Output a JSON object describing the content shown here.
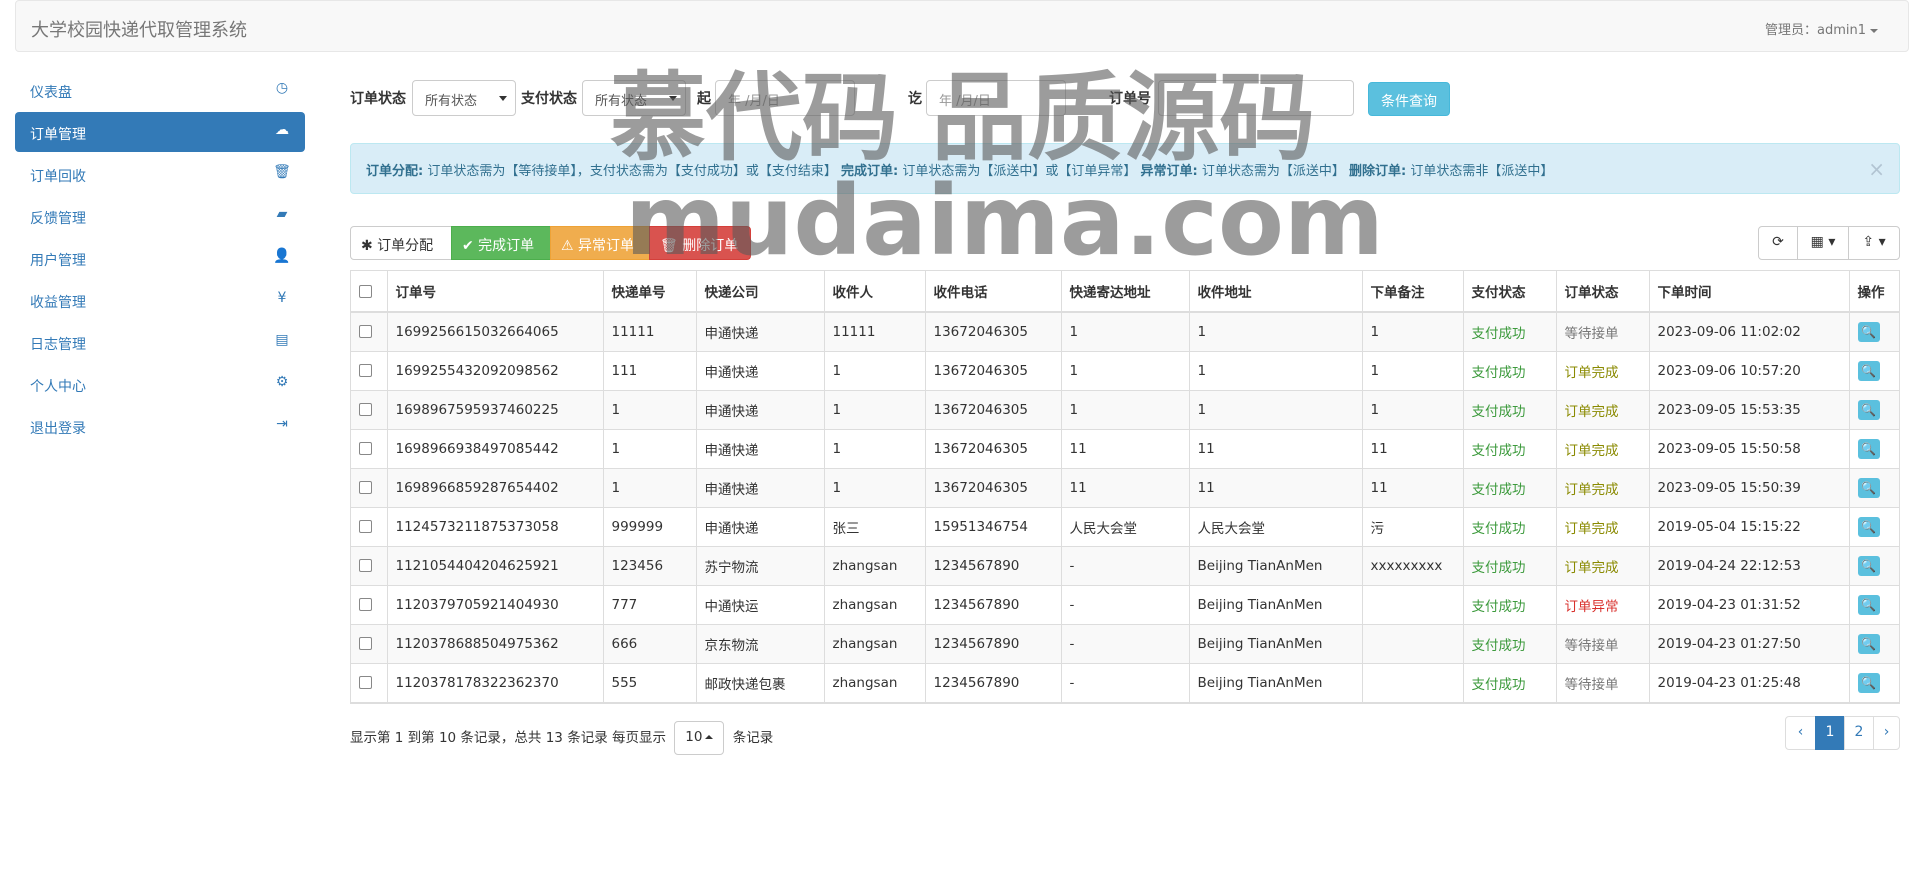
{
  "header": {
    "brand": "大学校园快递代取管理系统",
    "admin": "管理员：admin1"
  },
  "sidebar": {
    "items": [
      {
        "label": "仪表盘",
        "icon": "dashboard-icon",
        "glyph": "◷"
      },
      {
        "label": "订单管理",
        "icon": "cloud-upload-icon",
        "glyph": "☁"
      },
      {
        "label": "订单回收",
        "icon": "trash-icon",
        "glyph": "🗑"
      },
      {
        "label": "反馈管理",
        "icon": "comment-icon",
        "glyph": "▰"
      },
      {
        "label": "用户管理",
        "icon": "user-icon",
        "glyph": "👤"
      },
      {
        "label": "收益管理",
        "icon": "yen-icon",
        "glyph": "¥"
      },
      {
        "label": "日志管理",
        "icon": "list-alt-icon",
        "glyph": "▤"
      },
      {
        "label": "个人中心",
        "icon": "cog-icon",
        "glyph": "⚙"
      },
      {
        "label": "退出登录",
        "icon": "log-out-icon",
        "glyph": "⇥"
      }
    ],
    "active_index": 1
  },
  "filter": {
    "order_status_label": "订单状态",
    "order_status_value": "所有状态",
    "pay_status_label": "支付状态",
    "pay_status_value": "所有状态",
    "from_label": "起",
    "from_placeholder": "年 /月/日",
    "to_label": "讫",
    "to_placeholder": "年 /月/日",
    "order_no_label": "订单号",
    "order_no_value": "",
    "query_button": "条件查询"
  },
  "alert": {
    "t1": "订单分配:",
    "d1": "订单状态需为【等待接单】，支付状态需为【支付成功】或【支付结束】",
    "t2": "完成订单:",
    "d2": "订单状态需为【派送中】或【订单异常】",
    "t3": "异常订单:",
    "d3": "订单状态需为【派送中】",
    "t4": "删除订单:",
    "d4": "订单状态需非【派送中】",
    "close": "×"
  },
  "toolbar": {
    "assign": "✱ 订单分配",
    "complete": "✔ 完成订单",
    "abnormal": "⚠ 异常订单",
    "delete": "🗑 删除订单",
    "refresh": "⟳",
    "columns": "▦ ▾",
    "export": "⇪ ▾"
  },
  "table": {
    "headers": [
      "订单号",
      "快递单号",
      "快递公司",
      "收件人",
      "收件电话",
      "快递寄达地址",
      "收件地址",
      "下单备注",
      "支付状态",
      "订单状态",
      "下单时间",
      "操作"
    ],
    "rows": [
      [
        "1699256615032664065",
        "11111",
        "申通快递",
        "11111",
        "13672046305",
        "1",
        "1",
        "1",
        "支付成功",
        "等待接单",
        "2023-09-06 11:02:02"
      ],
      [
        "1699255432092098562",
        "111",
        "申通快递",
        "1",
        "13672046305",
        "1",
        "1",
        "1",
        "支付成功",
        "订单完成",
        "2023-09-06 10:57:20"
      ],
      [
        "1698967595937460225",
        "1",
        "申通快递",
        "1",
        "13672046305",
        "1",
        "1",
        "1",
        "支付成功",
        "订单完成",
        "2023-09-05 15:53:35"
      ],
      [
        "1698966938497085442",
        "1",
        "申通快递",
        "1",
        "13672046305",
        "11",
        "11",
        "11",
        "支付成功",
        "订单完成",
        "2023-09-05 15:50:58"
      ],
      [
        "1698966859287654402",
        "1",
        "申通快递",
        "1",
        "13672046305",
        "11",
        "11",
        "11",
        "支付成功",
        "订单完成",
        "2023-09-05 15:50:39"
      ],
      [
        "1124573211875373058",
        "999999",
        "申通快递",
        "张三",
        "15951346754",
        "人民大会堂",
        "人民大会堂",
        "污",
        "支付成功",
        "订单完成",
        "2019-05-04 15:15:22"
      ],
      [
        "1121054404204625921",
        "123456",
        "苏宁物流",
        "zhangsan",
        "1234567890",
        "-",
        "Beijing TianAnMen",
        "xxxxxxxxx",
        "支付成功",
        "订单完成",
        "2019-04-24 22:12:53"
      ],
      [
        "1120379705921404930",
        "777",
        "中通快运",
        "zhangsan",
        "1234567890",
        "-",
        "Beijing TianAnMen",
        "",
        "支付成功",
        "订单异常",
        "2019-04-23 01:31:52"
      ],
      [
        "1120378688504975362",
        "666",
        "京东物流",
        "zhangsan",
        "1234567890",
        "-",
        "Beijing TianAnMen",
        "",
        "支付成功",
        "等待接单",
        "2019-04-23 01:27:50"
      ],
      [
        "1120378178322362370",
        "555",
        "邮政快递包裹",
        "zhangsan",
        "1234567890",
        "-",
        "Beijing TianAnMen",
        "",
        "支付成功",
        "等待接单",
        "2019-04-23 01:25:48"
      ]
    ],
    "action_glyph": "🔍",
    "status_colors": {
      "支付成功": "#3c9a3c",
      "订单完成": "#8a8a00",
      "等待接单": "#777777",
      "订单异常": "#d9302c"
    }
  },
  "pagination": {
    "info_prefix": "显示第 1 到第 10 条记录，总共 13 条记录 每页显示",
    "page_size": "10",
    "info_suffix": "条记录",
    "prev": "‹",
    "pages": [
      "1",
      "2"
    ],
    "next": "›",
    "current": "1"
  },
  "watermark": {
    "line1": "慕代码 品质源码",
    "line2": "mudaima.com"
  }
}
